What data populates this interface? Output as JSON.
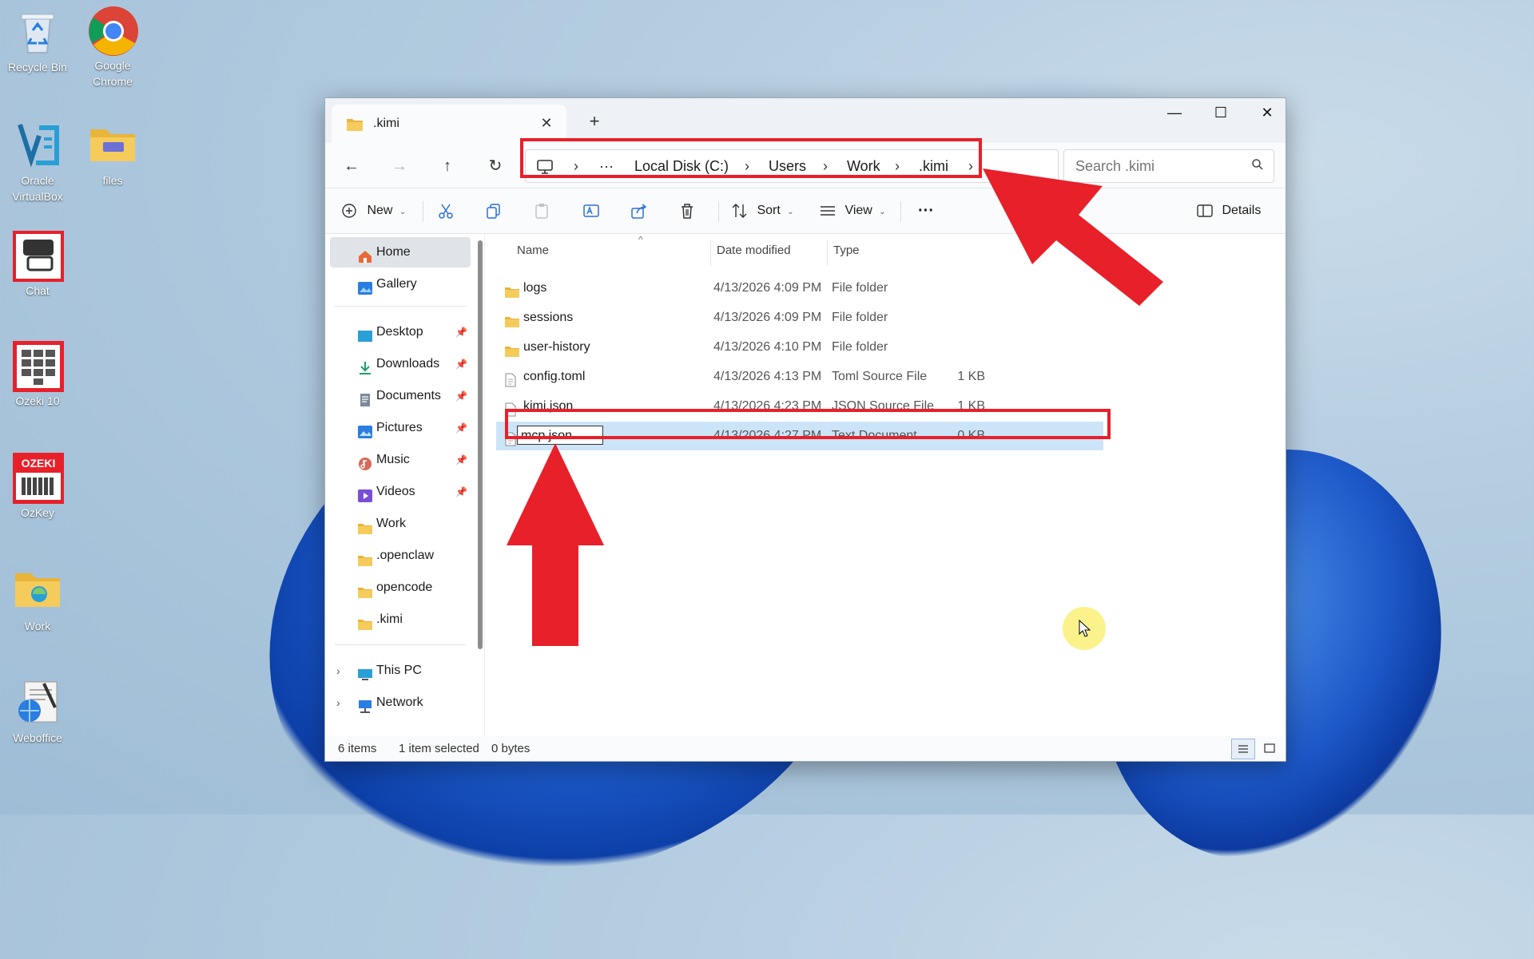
{
  "desktop": {
    "icons": [
      {
        "label": "Recycle Bin",
        "icon": "recycle-bin-icon"
      },
      {
        "label": "Google Chrome",
        "icon": "chrome-icon"
      },
      {
        "label": "Oracle VirtualBox",
        "icon": "virtualbox-icon"
      },
      {
        "label": "files",
        "icon": "folder-icon"
      },
      {
        "label": "Chat",
        "icon": "chat-icon"
      },
      {
        "label": "Ozeki 10",
        "icon": "ozeki-icon"
      },
      {
        "label": "OzKey",
        "icon": "ozkey-icon"
      },
      {
        "label": "Work",
        "icon": "folder-icon"
      },
      {
        "label": "Weboffice",
        "icon": "weboffice-icon"
      }
    ],
    "ozkey_badge": "OZEKI"
  },
  "window": {
    "tab_title": ".kimi",
    "address": {
      "segments": [
        "Local Disk (C:)",
        "Users",
        "Work",
        ".kimi"
      ],
      "ellipsis": "···"
    },
    "search": {
      "placeholder": "Search .kimi"
    },
    "commands": {
      "new": "New",
      "sort": "Sort",
      "view": "View",
      "more": "···",
      "details": "Details"
    },
    "sidebar": {
      "home": "Home",
      "gallery": "Gallery",
      "pinned": [
        "Desktop",
        "Downloads",
        "Documents",
        "Pictures",
        "Music",
        "Videos"
      ],
      "folders": [
        "Work",
        ".openclaw",
        "opencode",
        ".kimi"
      ],
      "this_pc": "This PC",
      "network": "Network"
    },
    "columns": {
      "name": "Name",
      "date": "Date modified",
      "type": "Type"
    },
    "files": [
      {
        "name": "logs",
        "date": "4/13/2026 4:09 PM",
        "type": "File folder",
        "size": "",
        "kind": "folder"
      },
      {
        "name": "sessions",
        "date": "4/13/2026 4:09 PM",
        "type": "File folder",
        "size": "",
        "kind": "folder"
      },
      {
        "name": "user-history",
        "date": "4/13/2026 4:10 PM",
        "type": "File folder",
        "size": "",
        "kind": "folder"
      },
      {
        "name": "config.toml",
        "date": "4/13/2026 4:13 PM",
        "type": "Toml Source File",
        "size": "1 KB",
        "kind": "file"
      },
      {
        "name": "kimi.json",
        "date": "4/13/2026 4:23 PM",
        "type": "JSON Source File",
        "size": "1 KB",
        "kind": "file"
      },
      {
        "name": "mcp.json",
        "date": "4/13/2026 4:27 PM",
        "type": "Text Document",
        "size": "0 KB",
        "kind": "file"
      }
    ],
    "status": {
      "items": "6 items",
      "selected": "1 item selected",
      "bytes": "0 bytes"
    }
  },
  "colors": {
    "accent_red": "#e8202a",
    "selection": "#cce4f7",
    "folder_yellow": "#f2c14e"
  }
}
